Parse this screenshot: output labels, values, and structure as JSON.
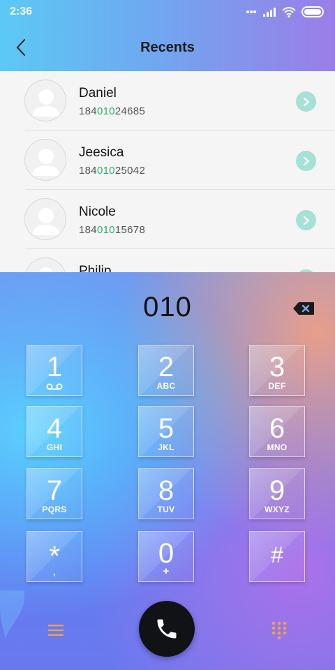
{
  "status_bar": {
    "time": "2:36"
  },
  "header": {
    "title": "Recents"
  },
  "recents": [
    {
      "name": "Daniel",
      "number_prefix": "184",
      "number_match": "010",
      "number_suffix": "24685"
    },
    {
      "name": "Jeesica",
      "number_prefix": "184",
      "number_match": "010",
      "number_suffix": "25042"
    },
    {
      "name": "Nicole",
      "number_prefix": "184",
      "number_match": "010",
      "number_suffix": "15678"
    },
    {
      "name": "Philip",
      "number_prefix": "",
      "number_match": "",
      "number_suffix": ""
    }
  ],
  "dialer": {
    "number": "010"
  },
  "keypad": [
    {
      "digit": "1",
      "letters": "",
      "sub_icon": "voicemail-icon"
    },
    {
      "digit": "2",
      "letters": "ABC"
    },
    {
      "digit": "3",
      "letters": "DEF"
    },
    {
      "digit": "4",
      "letters": "GHI"
    },
    {
      "digit": "5",
      "letters": "JKL"
    },
    {
      "digit": "6",
      "letters": "MNO"
    },
    {
      "digit": "7",
      "letters": "PQRS"
    },
    {
      "digit": "8",
      "letters": "TUV"
    },
    {
      "digit": "9",
      "letters": "WXYZ"
    },
    {
      "digit": "*",
      "letters": ","
    },
    {
      "digit": "0",
      "letters": "+"
    },
    {
      "digit": "#",
      "letters": ""
    }
  ],
  "colors": {
    "accent_green": "#2ab06a",
    "detail_button": "#a5e1d4",
    "call_button": "#111216",
    "bottom_icons": "#f0a050"
  }
}
